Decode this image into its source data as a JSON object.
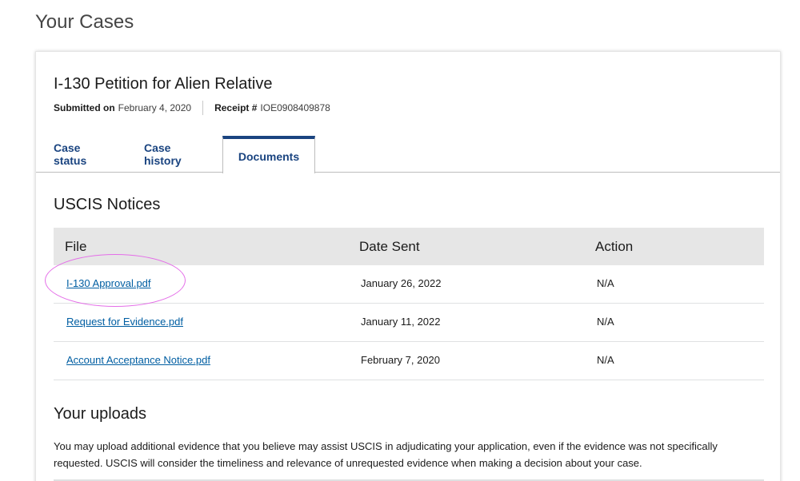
{
  "page": {
    "title": "Your Cases"
  },
  "case": {
    "title": "I-130 Petition for Alien Relative",
    "submitted_label": "Submitted on",
    "submitted_value": "February 4, 2020",
    "receipt_label": "Receipt #",
    "receipt_value": "IOE0908409878"
  },
  "tabs": [
    {
      "label": "Case status",
      "active": false
    },
    {
      "label": "Case history",
      "active": false
    },
    {
      "label": "Documents",
      "active": true
    }
  ],
  "notices": {
    "title": "USCIS Notices",
    "columns": [
      "File",
      "Date Sent",
      "Action"
    ],
    "rows": [
      {
        "file": "I-130 Approval.pdf",
        "date": "January 26, 2022",
        "action": "N/A"
      },
      {
        "file": "Request for Evidence.pdf",
        "date": "January 11, 2022",
        "action": "N/A"
      },
      {
        "file": "Account Acceptance Notice.pdf",
        "date": "February 7, 2020",
        "action": "N/A"
      }
    ]
  },
  "uploads": {
    "title": "Your uploads",
    "description": "You may upload additional evidence that you believe may assist USCIS in adjudicating your application, even if the evidence was not specifically requested. USCIS will consider the timeliness and relevance of unrequested evidence when making a decision about your case."
  },
  "colors": {
    "link": "#005ea2",
    "tab_active_border": "#1a4480",
    "highlight": "#e46ee8",
    "table_header_bg": "#e6e6e6"
  }
}
